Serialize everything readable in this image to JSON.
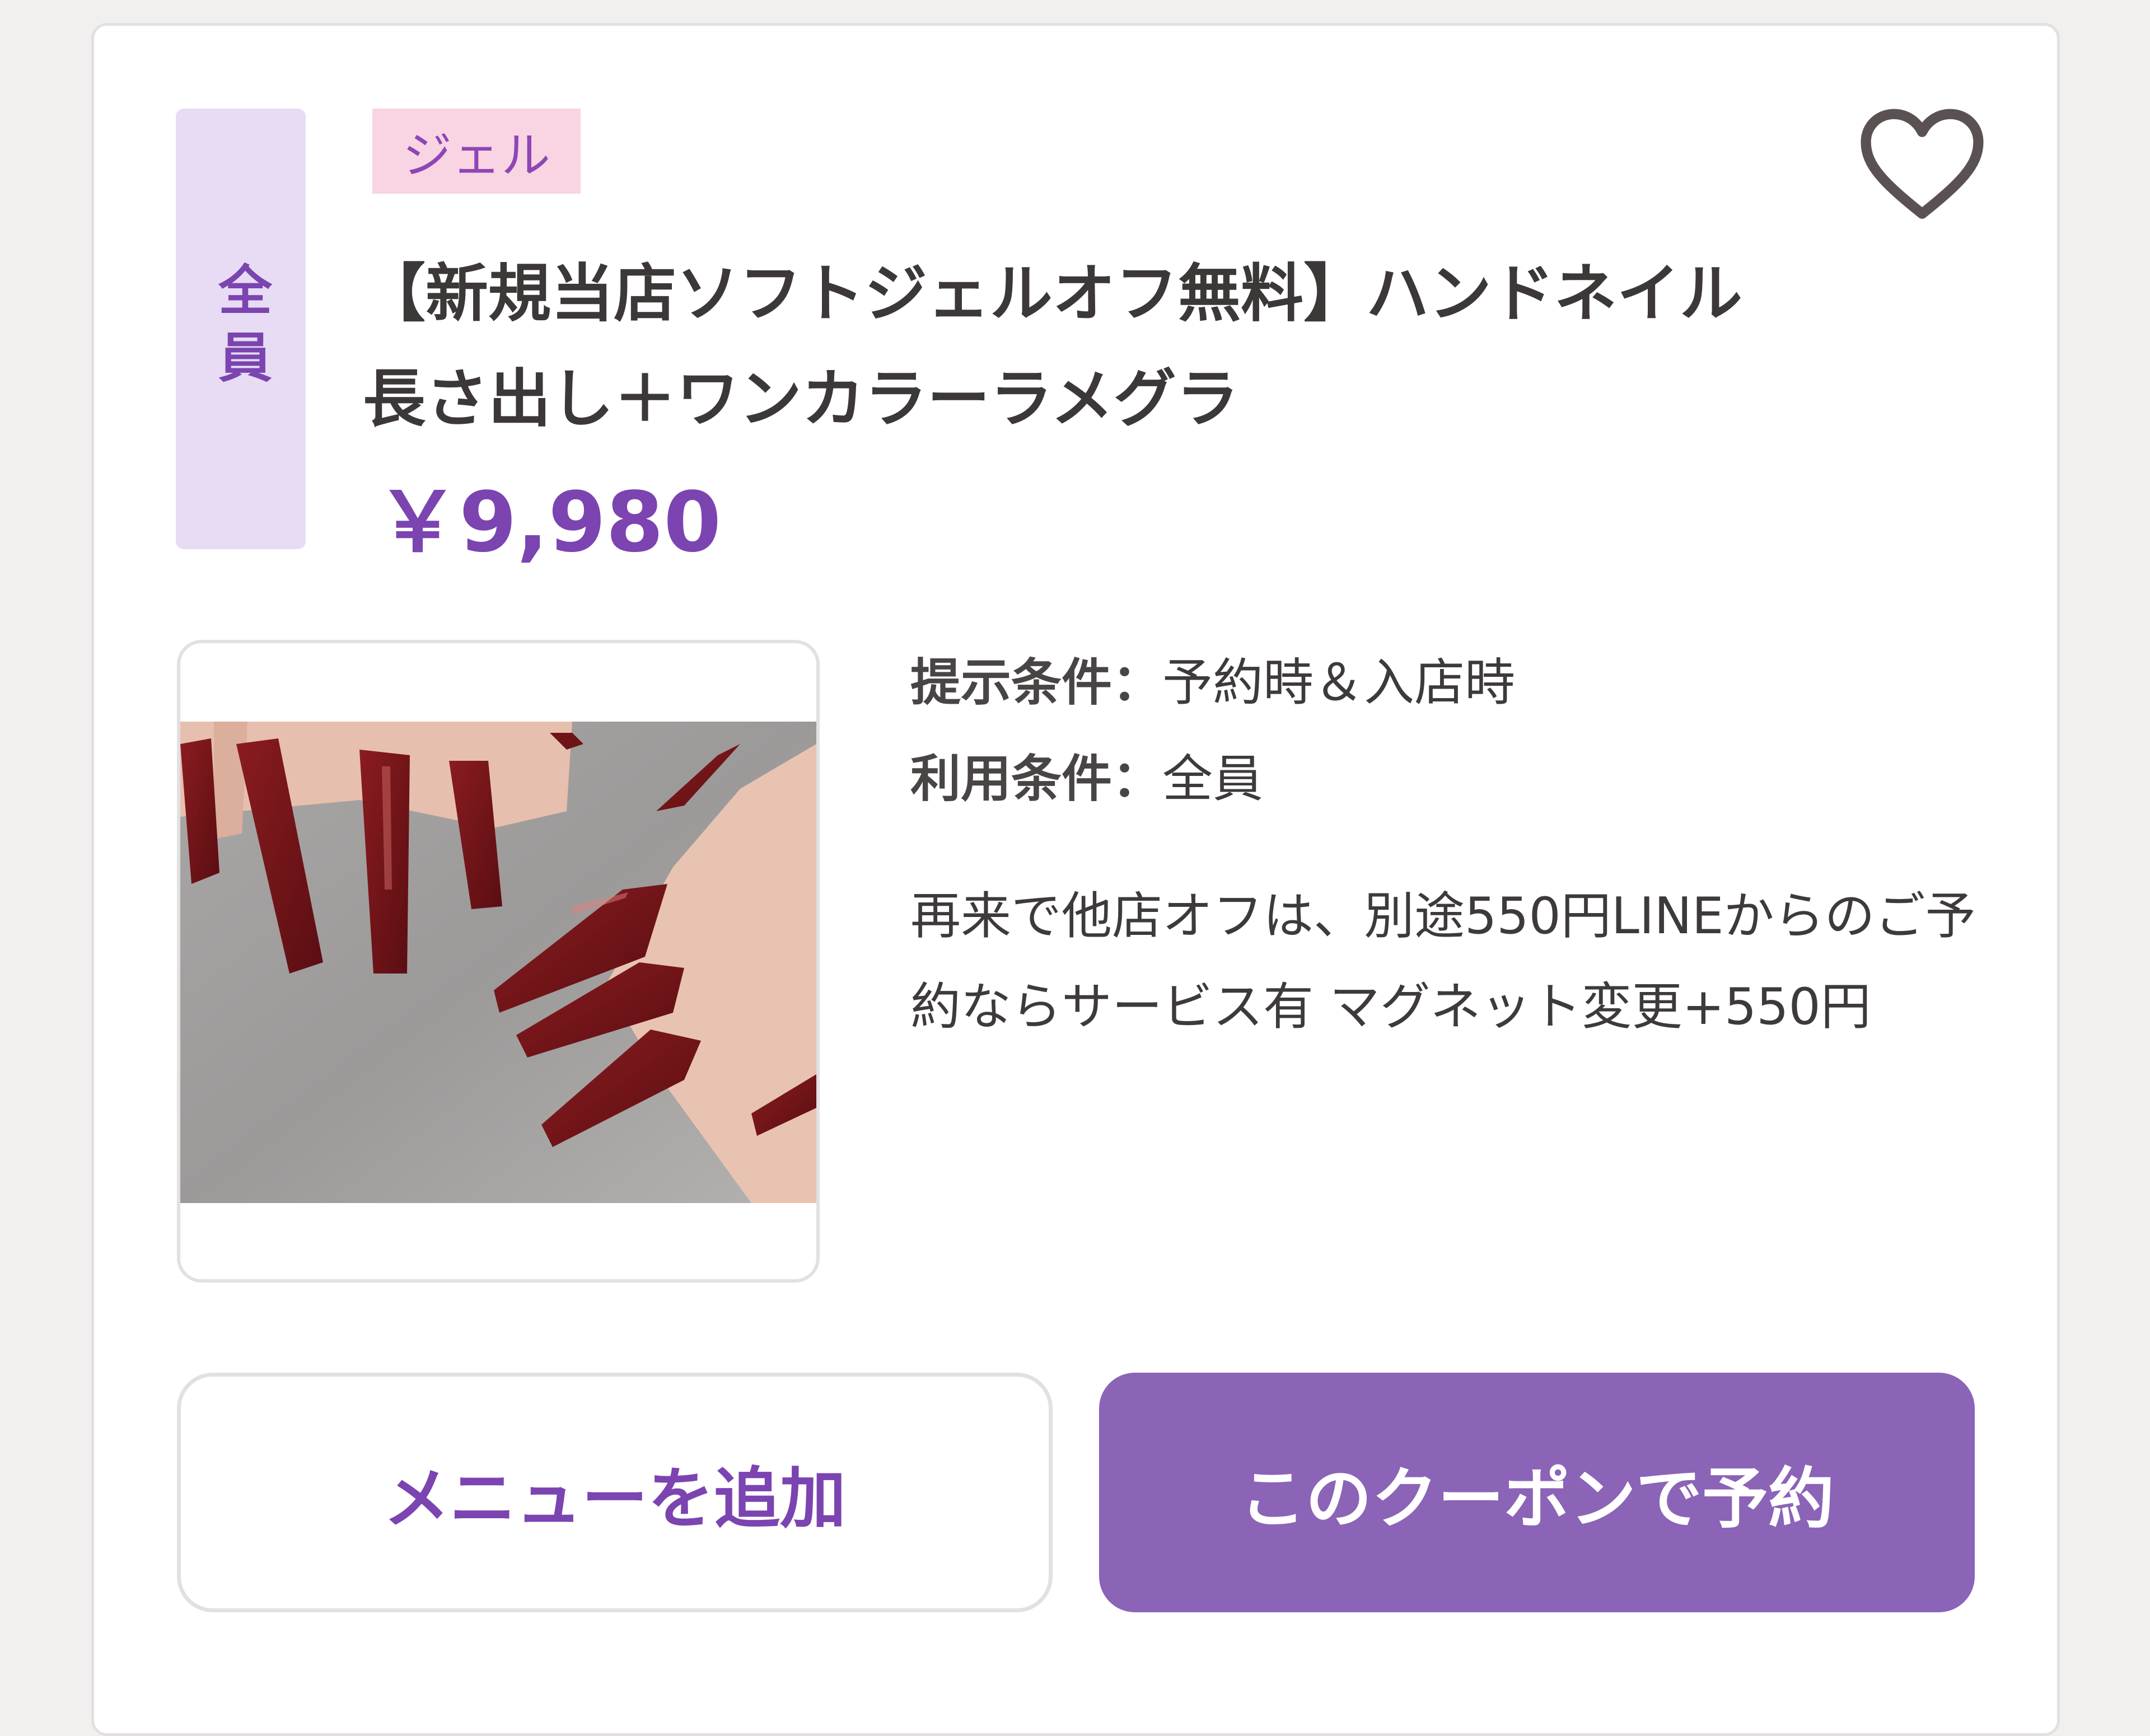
{
  "coupon": {
    "target_badge": "全員",
    "category_tag": "ジェル",
    "favorite_icon": "heart-outline-icon",
    "title_line1": "【新規当店ソフトジェルオフ無料】ハンドネイル",
    "title_line2": "長さ出し＋ワンカラーラメグラ",
    "price": "￥9,980",
    "image_alt": "long coffin-shaped dark red gel nails",
    "conditions": [
      {
        "label": "提示条件：",
        "value": "予約時＆入店時"
      },
      {
        "label": "利用条件：",
        "value": "全員"
      }
    ],
    "description": "再来で他店オフは、別途550円LINEからのご予約ならサービス有 マグネット変更+550円"
  },
  "buttons": {
    "add_menu": "メニューを追加",
    "reserve": "このクーポンで予約"
  },
  "colors": {
    "accent": "#7b44b0",
    "button_primary": "#8b63b7",
    "badge_bg": "#e7dcf3",
    "tag_bg": "#f9d4e3",
    "nail": "#6e1316"
  }
}
